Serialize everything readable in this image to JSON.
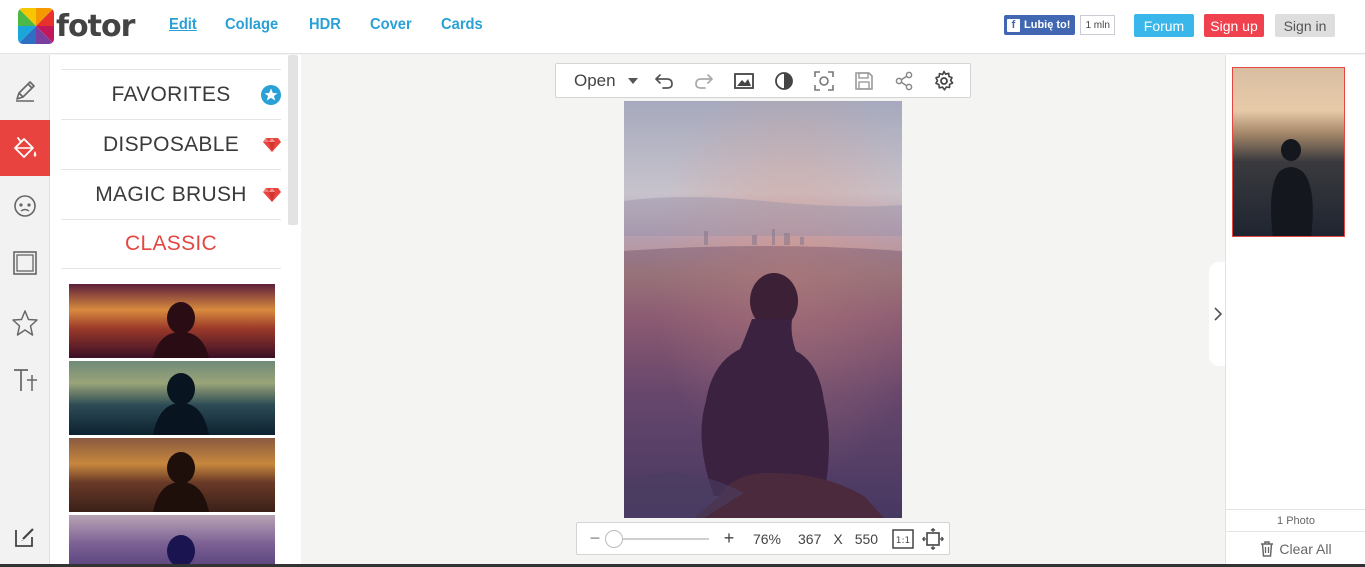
{
  "header": {
    "logo_text": "fotor",
    "nav": [
      {
        "label": "Edit"
      },
      {
        "label": "Collage"
      },
      {
        "label": "HDR"
      },
      {
        "label": "Cover"
      },
      {
        "label": "Cards"
      }
    ],
    "facebook_like": "Lubię to!",
    "facebook_count": "1 mln",
    "forum": "Forum",
    "sign_up": "Sign up",
    "sign_in": "Sign in"
  },
  "rail": {
    "items": [
      "pencil-icon",
      "paint-bucket-icon",
      "face-icon",
      "frame-icon",
      "star-icon",
      "text-icon",
      "edit-note-icon"
    ],
    "active_index": 1,
    "active_color": "#e8433e"
  },
  "categories": [
    {
      "label": "FAVORITES",
      "badge": "star-badge-icon"
    },
    {
      "label": "DISPOSABLE",
      "badge": "gem-icon"
    },
    {
      "label": "MAGIC BRUSH",
      "badge": "gem-icon"
    },
    {
      "label": "CLASSIC",
      "badge": ""
    }
  ],
  "toolbar": {
    "open_label": "Open",
    "icons": [
      "undo-icon",
      "redo-icon",
      "image-icon",
      "contrast-icon",
      "screenshot-icon",
      "save-icon",
      "share-icon",
      "settings-icon"
    ]
  },
  "zoom": {
    "zoom_percent": "76%",
    "width": "367",
    "x_sep": "X",
    "height": "550",
    "ratio_label": "1:1"
  },
  "right_panel": {
    "photo_count": "1 Photo",
    "clear_all": "Clear All"
  },
  "colors": {
    "accent_blue": "#2aa1d6",
    "accent_red": "#e8433e",
    "forum": "#39b6ea",
    "sign_up": "#f0414f"
  }
}
